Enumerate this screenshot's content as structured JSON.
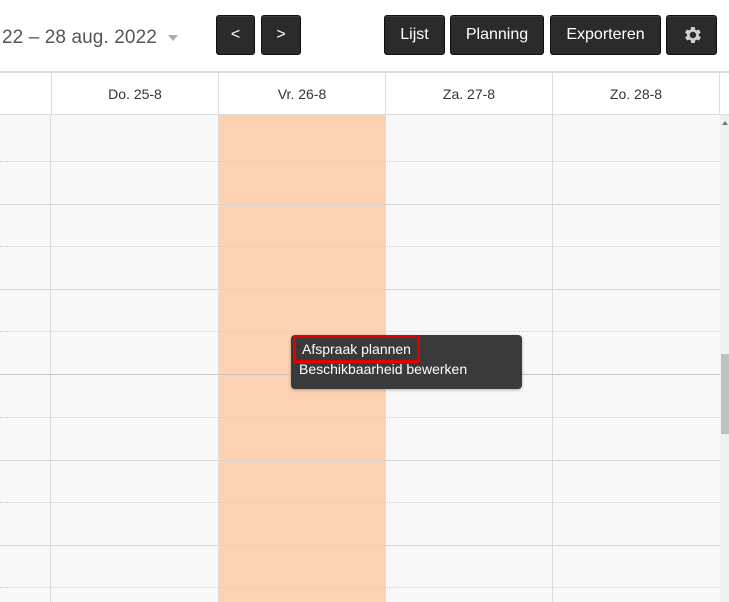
{
  "toolbar": {
    "date_range": "22 – 28 aug. 2022",
    "date_caret_icon": "caret-down-icon",
    "prev_label": "<",
    "next_label": ">",
    "list_label": "Lijst",
    "planning_label": "Planning",
    "export_label": "Exporteren",
    "settings_icon": "gear-icon"
  },
  "calendar": {
    "days": [
      {
        "label": ""
      },
      {
        "label": "Do. 25-8"
      },
      {
        "label": "Vr. 26-8"
      },
      {
        "label": "Za. 27-8"
      },
      {
        "label": "Zo. 28-8"
      }
    ],
    "highlighted_day": "Vr. 26-8",
    "highlight_color": "#fdd2b2"
  },
  "context_menu": {
    "items": [
      {
        "label": "Afspraak plannen",
        "active": true
      },
      {
        "label": "Beschikbaarheid bewerken",
        "active": false
      }
    ],
    "active_outline_color": "#e00000"
  }
}
